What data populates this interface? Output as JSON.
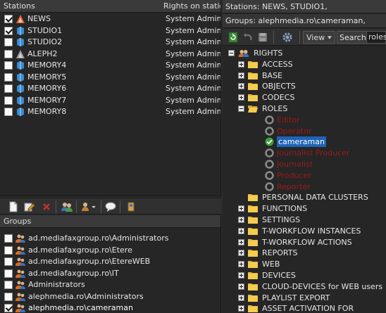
{
  "stations": {
    "header_label": "Stations",
    "header_rights": "Rights on station",
    "rows": [
      {
        "name": "NEWS",
        "rights": "System Admin",
        "checked": true,
        "icon": "news-station-icon"
      },
      {
        "name": "STUDIO1",
        "rights": "System Admin",
        "checked": true,
        "icon": "station-icon"
      },
      {
        "name": "STUDIO2",
        "rights": "System Admin",
        "checked": false,
        "icon": "station-icon"
      },
      {
        "name": "ALEPH2",
        "rights": "System Admin",
        "checked": false,
        "icon": "station-grey-icon"
      },
      {
        "name": "MEMORY4",
        "rights": "System Admin",
        "checked": false,
        "icon": "station-icon"
      },
      {
        "name": "MEMORY5",
        "rights": "System Admin",
        "checked": false,
        "icon": "station-icon"
      },
      {
        "name": "MEMORY6",
        "rights": "System Admin",
        "checked": false,
        "icon": "station-icon"
      },
      {
        "name": "MEMORY7",
        "rights": "System Admin",
        "checked": false,
        "icon": "station-icon"
      },
      {
        "name": "MEMORY8",
        "rights": "System Admin",
        "checked": false,
        "icon": "station-icon"
      }
    ]
  },
  "left_toolbar": {
    "icons": [
      "new-icon",
      "edit-icon",
      "delete-icon",
      "users-icon",
      "user-dropdown-icon",
      "chat-icon",
      "export-icon"
    ]
  },
  "groups": {
    "header_label": "Groups",
    "rows": [
      {
        "name": "ad.mediafaxgroup.ro\\Administrators",
        "checked": false
      },
      {
        "name": "ad.mediafaxgroup.ro\\Etere",
        "checked": false
      },
      {
        "name": "ad.mediafaxgroup.ro\\EtereWEB",
        "checked": false
      },
      {
        "name": "ad.mediafaxgroup.ro\\IT",
        "checked": false
      },
      {
        "name": "Administrators",
        "checked": false
      },
      {
        "name": "alephmedia.ro\\Administrators",
        "checked": false
      },
      {
        "name": "alephmedia.ro\\cameraman",
        "checked": true
      }
    ]
  },
  "right": {
    "header": "Stations: NEWS, STUDIO1,",
    "groups_line": "Groups: alephmedia.ro\\cameraman,",
    "toolbar": {
      "view_label": "View",
      "search_label": "Search",
      "search_value": "roles"
    },
    "tree": {
      "root": "RIGHTS",
      "nodes": [
        {
          "label": "ACCESS",
          "expanded": false
        },
        {
          "label": "BASE",
          "expanded": false
        },
        {
          "label": "OBJECTS",
          "expanded": false
        },
        {
          "label": "CODECS",
          "expanded": false
        },
        {
          "label": "ROLES",
          "expanded": true
        }
      ],
      "roles": [
        {
          "label": "Editor",
          "state": "disabled"
        },
        {
          "label": "Operator",
          "state": "disabled"
        },
        {
          "label": "cameraman",
          "state": "checked"
        },
        {
          "label": "Journalist Producer",
          "state": "disabled"
        },
        {
          "label": "Journalist",
          "state": "disabled"
        },
        {
          "label": "Producer",
          "state": "disabled"
        },
        {
          "label": "Reporter",
          "state": "disabled"
        }
      ],
      "after_nodes": [
        {
          "label": "PERSONAL DATA CLUSTERS",
          "expandable": false
        },
        {
          "label": "FUNCTIONS",
          "expandable": true
        },
        {
          "label": "SETTINGS",
          "expandable": true
        },
        {
          "label": "T-WORKFLOW INSTANCES",
          "expandable": true
        },
        {
          "label": "T-WORKFLOW ACTIONS",
          "expandable": true
        },
        {
          "label": "REPORTS",
          "expandable": true
        },
        {
          "label": "WEB",
          "expandable": true
        },
        {
          "label": "DEVICES",
          "expandable": true
        },
        {
          "label": "CLOUD-DEVICES for WEB users",
          "expandable": true
        },
        {
          "label": "PLAYLIST EXPORT",
          "expandable": true
        },
        {
          "label": "ASSET ACTIVATION FOR",
          "expandable": true
        }
      ]
    }
  },
  "colors": {
    "selection": "#1f63b5",
    "disabled_role_text": "#9a1a1a",
    "folder": "#f0c040"
  }
}
